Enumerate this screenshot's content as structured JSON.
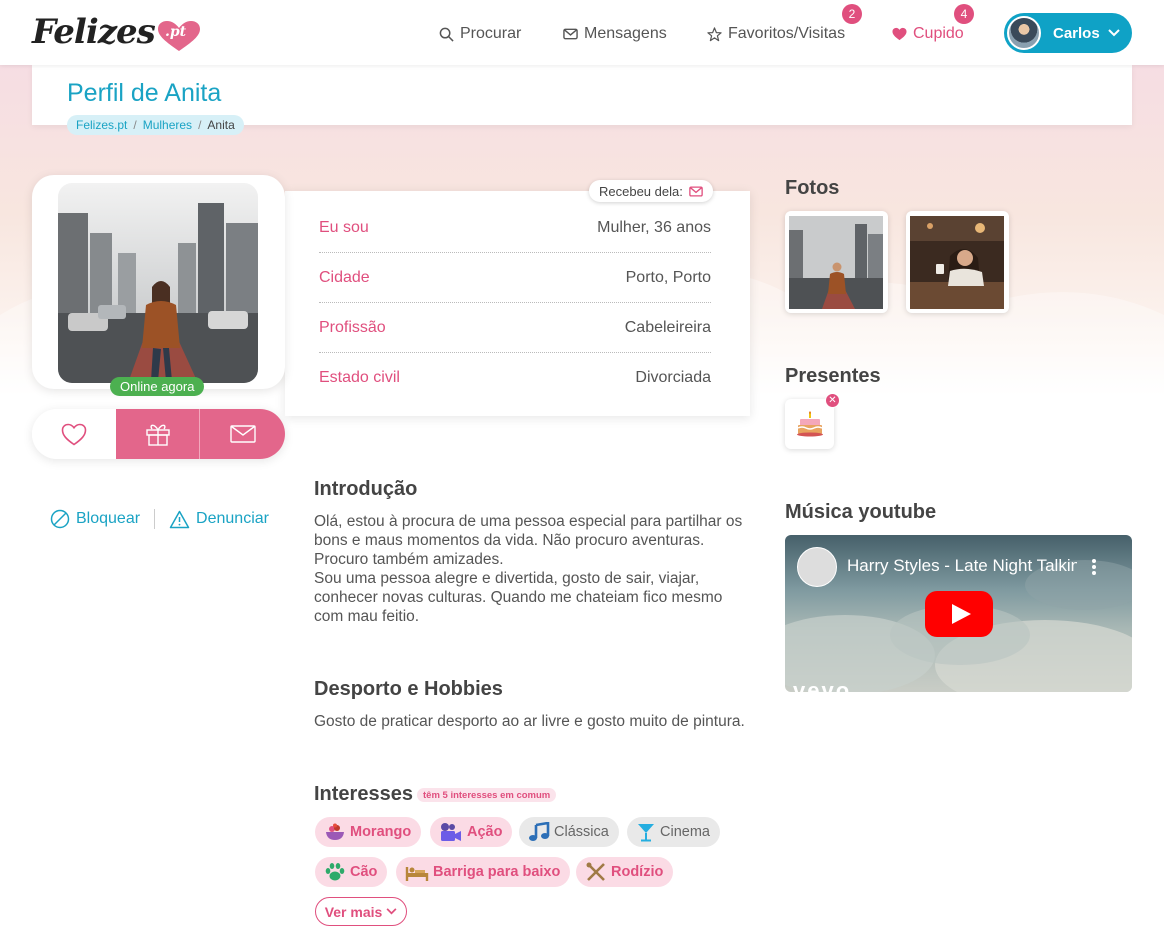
{
  "header": {
    "logo_text": "Felizes",
    "logo_suffix": ".pt",
    "nav": {
      "search": "Procurar",
      "messages": "Mensagens",
      "favorites": "Favoritos/Visitas",
      "favorites_badge": "2",
      "cupid": "Cupido",
      "cupid_badge": "4"
    },
    "user_name": "Carlos"
  },
  "profile": {
    "title": "Perfil de Anita",
    "breadcrumb": [
      "Felizes.pt",
      "Mulheres",
      "Anita"
    ],
    "online_label": "Online agora",
    "received_label": "Recebeu dela:",
    "info": [
      {
        "key": "Eu sou",
        "value": "Mulher, 36 anos"
      },
      {
        "key": "Cidade",
        "value": "Porto, Porto"
      },
      {
        "key": "Profissão",
        "value": "Cabeleireira"
      },
      {
        "key": "Estado civil",
        "value": "Divorciada"
      }
    ],
    "block_label": "Bloquear",
    "report_label": "Denunciar"
  },
  "sections": {
    "intro_title": "Introdução",
    "intro_lines": [
      "Olá, estou à procura de uma pessoa especial para partilhar os",
      "bons e maus momentos da vida. Não procuro aventuras.",
      "Procuro também amizades.",
      "Sou uma pessoa alegre e divertida, gosto de sair, viajar,",
      "conhecer novas culturas. Quando me chateiam fico mesmo",
      "com mau feitio."
    ],
    "hobbies_title": "Desporto e Hobbies",
    "hobbies_text": "Gosto de praticar desporto ao ar livre e gosto muito de pintura.",
    "interests_title": "Interesses",
    "interests_common": "têm 5 interesses em comum",
    "interests": [
      {
        "label": "Morango",
        "icon": "strawberry-bowl-icon",
        "common": true
      },
      {
        "label": "Ação",
        "icon": "movie-camera-icon",
        "common": true
      },
      {
        "label": "Clássica",
        "icon": "music-note-icon",
        "common": false
      },
      {
        "label": "Cinema",
        "icon": "cocktail-icon",
        "common": false
      },
      {
        "label": "Cão",
        "icon": "paw-icon",
        "common": true
      },
      {
        "label": "Barriga para baixo",
        "icon": "bed-icon",
        "common": true
      },
      {
        "label": "Rodízio",
        "icon": "cutlery-icon",
        "common": true
      }
    ],
    "more_label": "Ver mais"
  },
  "sidebar": {
    "photos_title": "Fotos",
    "gifts_title": "Presentes",
    "music_title": "Música youtube",
    "video_title": "Harry Styles - Late Night Talking",
    "video_logo": "vevo"
  },
  "colors": {
    "accent_pink": "#e04f7e",
    "accent_blue": "#1aa3c4",
    "online_green": "#4cb050"
  }
}
